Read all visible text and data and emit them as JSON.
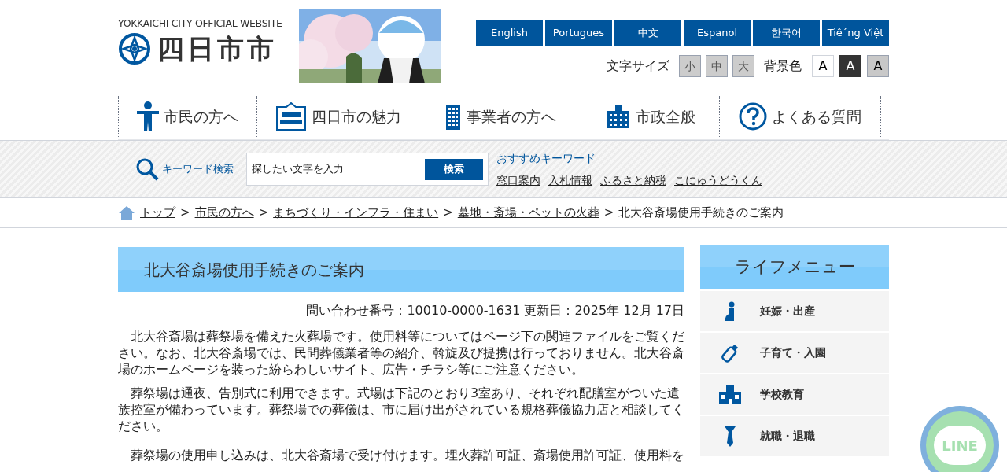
{
  "header": {
    "site_label": "YOKKAICHI CITY OFFICIAL WEBSITE",
    "logo_text": "四日市市",
    "languages": [
      "English",
      "Portugues",
      "中文",
      "Espanol",
      "한국어",
      "Tiê´ng Việt"
    ],
    "font_size": {
      "label": "文字サイズ",
      "options": [
        {
          "label": "小",
          "selected": false
        },
        {
          "label": "中",
          "selected": false
        },
        {
          "label": "大",
          "selected": false
        }
      ]
    },
    "background": {
      "label": "背景色",
      "options": [
        {
          "label": "A",
          "kind": "white"
        },
        {
          "label": "A",
          "kind": "black"
        },
        {
          "label": "A",
          "kind": "gray"
        }
      ]
    }
  },
  "nav": [
    {
      "label": "市民の方へ",
      "kind": "person"
    },
    {
      "label": "四日市の魅力",
      "kind": "style"
    },
    {
      "label": "事業者の方へ",
      "kind": "building"
    },
    {
      "label": "市政全般",
      "kind": "cityhall"
    },
    {
      "label": "よくある質問",
      "kind": "question"
    }
  ],
  "search": {
    "label": "キーワード検索",
    "placeholder": "探したい文字を入力",
    "button": "検索",
    "recommended_label": "おすすめキーワード",
    "keywords": [
      "窓口案内",
      "入札情報",
      "ふるさと納税",
      "こにゅうどうくん"
    ]
  },
  "breadcrumb": {
    "separator": ">",
    "links": [
      "トップ",
      "市民の方へ",
      "まちづくり・インフラ・住まい",
      "墓地・斎場・ペットの火葬"
    ],
    "current": "北大谷斎場使用手続きのご案内"
  },
  "article": {
    "title": "北大谷斎場使用手続きのご案内",
    "meta": "問い合わせ番号：10010-0000-1631 更新日：2025年 12月 17日",
    "paragraphs": [
      "北大谷斎場は葬祭場を備えた火葬場です。使用料等についてはページ下の関連ファイルをご覧ください。なお、北大谷斎場では、民間葬儀業者等の紹介、斡旋及び提携は行っておりません。北大谷斎場のホームページを装った紛らわしいサイト、広告・チラシ等にご注意ください。",
      "葬祭場は通夜、告別式に利用できます。式場は下記のとおり3室あり、それぞれ配膳室がついた遺族控室が備わっています。葬祭場での葬儀は、市に届け出がされている規格葬儀協力店と相談してください。",
      "葬祭場の使用申し込みは、北大谷斎場で受け付けます。埋火葬許可証、斎場使用許可証、使用料を"
    ]
  },
  "life_menu": {
    "title": "ライフメニュー",
    "items": [
      {
        "label": "妊娠・出産",
        "kind": "pregnancy"
      },
      {
        "label": "子育て・入園",
        "kind": "bottle"
      },
      {
        "label": "学校教育",
        "kind": "school"
      },
      {
        "label": "就職・退職",
        "kind": "tie"
      }
    ]
  },
  "line_button": {
    "label": "LINE"
  }
}
